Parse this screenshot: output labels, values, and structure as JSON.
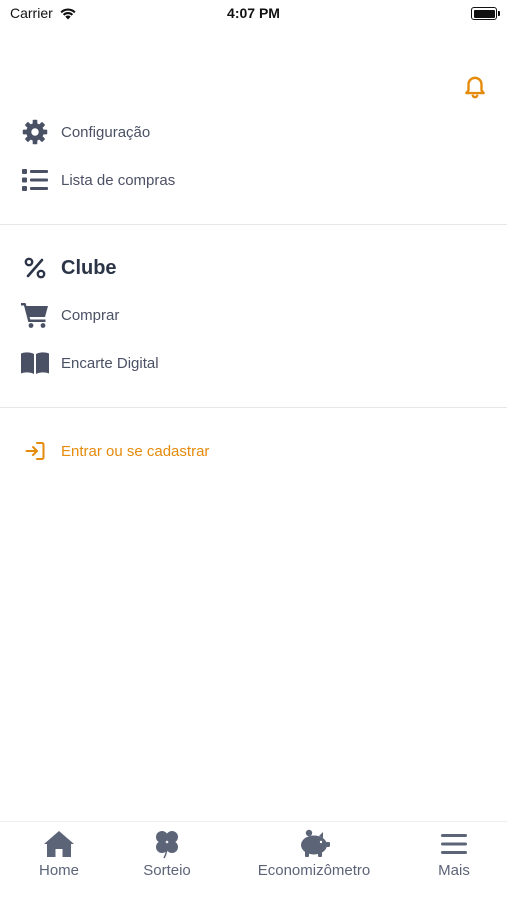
{
  "status_bar": {
    "carrier": "Carrier",
    "time": "4:07 PM"
  },
  "menu": {
    "section1": [
      {
        "label": "Configuração",
        "icon": "gear-icon"
      },
      {
        "label": "Lista de compras",
        "icon": "list-icon"
      }
    ],
    "clube": {
      "label": "Clube",
      "icon": "percent-icon"
    },
    "section2": [
      {
        "label": "Comprar",
        "icon": "cart-icon"
      },
      {
        "label": "Encarte Digital",
        "icon": "book-icon"
      }
    ],
    "login": {
      "label": "Entrar ou se cadastrar",
      "icon": "sign-in-icon"
    }
  },
  "tabbar": [
    {
      "label": "Home",
      "icon": "home-icon"
    },
    {
      "label": "Sorteio",
      "icon": "clover-icon"
    },
    {
      "label": "Economizômetro",
      "icon": "piggy-bank-icon"
    },
    {
      "label": "Mais",
      "icon": "hamburger-icon"
    }
  ],
  "colors": {
    "accent": "#e58b0c",
    "icon": "#4a5164",
    "divider": "#e6e7ea"
  }
}
